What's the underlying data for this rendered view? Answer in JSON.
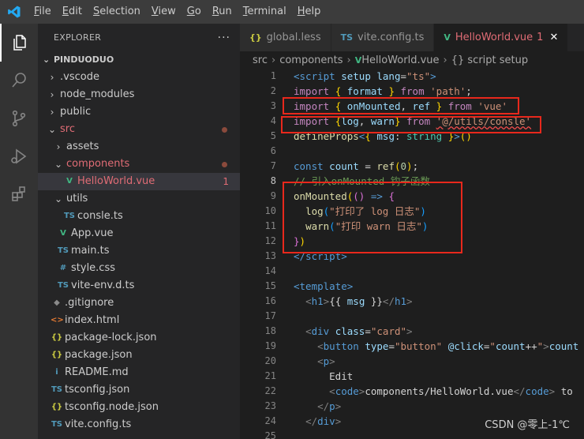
{
  "menubar": {
    "items": [
      "File",
      "Edit",
      "Selection",
      "View",
      "Go",
      "Run",
      "Terminal",
      "Help"
    ]
  },
  "activitybar": {
    "icons": [
      "files-icon",
      "search-icon",
      "source-control-icon",
      "run-debug-icon",
      "extensions-icon"
    ]
  },
  "explorer": {
    "title": "EXPLORER",
    "more": "···",
    "project": "PINDUODUO",
    "items": [
      {
        "label": ".vscode",
        "kind": "folder",
        "depth": 1,
        "open": false
      },
      {
        "label": "node_modules",
        "kind": "folder",
        "depth": 1,
        "open": false
      },
      {
        "label": "public",
        "kind": "folder",
        "depth": 1,
        "open": false
      },
      {
        "label": "src",
        "kind": "folder",
        "depth": 1,
        "open": true,
        "modified": true
      },
      {
        "label": "assets",
        "kind": "folder",
        "depth": 2,
        "open": false
      },
      {
        "label": "components",
        "kind": "folder",
        "depth": 2,
        "open": true,
        "modified": true
      },
      {
        "label": "HelloWorld.vue",
        "kind": "vue",
        "depth": 3,
        "selected": true,
        "problems": "1"
      },
      {
        "label": "utils",
        "kind": "folder",
        "depth": 2,
        "open": true
      },
      {
        "label": "consle.ts",
        "kind": "ts",
        "depth": 3
      },
      {
        "label": "App.vue",
        "kind": "vue",
        "depth": 2
      },
      {
        "label": "main.ts",
        "kind": "ts",
        "depth": 2
      },
      {
        "label": "style.css",
        "kind": "css",
        "depth": 2
      },
      {
        "label": "vite-env.d.ts",
        "kind": "ts",
        "depth": 2
      },
      {
        "label": ".gitignore",
        "kind": "git",
        "depth": 1
      },
      {
        "label": "index.html",
        "kind": "html",
        "depth": 1
      },
      {
        "label": "package-lock.json",
        "kind": "json",
        "depth": 1
      },
      {
        "label": "package.json",
        "kind": "json",
        "depth": 1
      },
      {
        "label": "README.md",
        "kind": "md",
        "depth": 1
      },
      {
        "label": "tsconfig.json",
        "kind": "tsconfig",
        "depth": 1
      },
      {
        "label": "tsconfig.node.json",
        "kind": "json",
        "depth": 1
      },
      {
        "label": "vite.config.ts",
        "kind": "ts",
        "depth": 1
      }
    ]
  },
  "tabs": [
    {
      "label": "global.less",
      "icon": "{}",
      "active": false
    },
    {
      "label": "vite.config.ts",
      "icon": "TS",
      "active": false
    },
    {
      "label": "HelloWorld.vue",
      "icon": "V",
      "active": true,
      "badge": "1",
      "close": "✕"
    }
  ],
  "breadcrumb": [
    "src",
    "components",
    "HelloWorld.vue",
    "{} script setup"
  ],
  "editor": {
    "current_line": 8,
    "lines": [
      [
        [
          "tag",
          "<"
        ],
        [
          "k",
          "script"
        ],
        [
          "v",
          " setup"
        ],
        [
          "d",
          " "
        ],
        [
          "v",
          "lang"
        ],
        [
          "d",
          "="
        ],
        [
          "s",
          "\"ts\""
        ],
        [
          "tag",
          ">"
        ]
      ],
      [
        [
          "kc",
          "import"
        ],
        [
          "d",
          " "
        ],
        [
          "b1",
          "{"
        ],
        [
          "d",
          " "
        ],
        [
          "v",
          "format"
        ],
        [
          "d",
          " "
        ],
        [
          "b1",
          "}"
        ],
        [
          "d",
          " "
        ],
        [
          "kc",
          "from"
        ],
        [
          "d",
          " "
        ],
        [
          "s",
          "'path'"
        ],
        [
          "d",
          ";"
        ]
      ],
      [
        [
          "kc",
          "import"
        ],
        [
          "d",
          " "
        ],
        [
          "b1",
          "{"
        ],
        [
          "d",
          " "
        ],
        [
          "v",
          "onMounted"
        ],
        [
          "d",
          ", "
        ],
        [
          "v",
          "ref"
        ],
        [
          "d",
          " "
        ],
        [
          "b1",
          "}"
        ],
        [
          "d",
          " "
        ],
        [
          "kc",
          "from"
        ],
        [
          "d",
          " "
        ],
        [
          "s",
          "'vue'"
        ]
      ],
      [
        [
          "kc",
          "import"
        ],
        [
          "d",
          " "
        ],
        [
          "b1",
          "{"
        ],
        [
          "v",
          "log"
        ],
        [
          "d",
          ", "
        ],
        [
          "v",
          "warn"
        ],
        [
          "b1",
          "}"
        ],
        [
          "d",
          " "
        ],
        [
          "kc",
          "from"
        ],
        [
          "d",
          " "
        ],
        [
          "sq",
          "'@/utils/consle'"
        ]
      ],
      [
        [
          "f",
          "defineProps"
        ],
        [
          "tag",
          "<"
        ],
        [
          "b1",
          "{"
        ],
        [
          "d",
          " "
        ],
        [
          "v",
          "msg"
        ],
        [
          "d",
          ": "
        ],
        [
          "t",
          "string"
        ],
        [
          "d",
          " "
        ],
        [
          "b1",
          "}"
        ],
        [
          "tag",
          ">"
        ],
        [
          "b1",
          "("
        ],
        [
          "b1",
          ")"
        ]
      ],
      [],
      [
        [
          "k",
          "const"
        ],
        [
          "d",
          " "
        ],
        [
          "v",
          "count"
        ],
        [
          "d",
          " = "
        ],
        [
          "f",
          "ref"
        ],
        [
          "b1",
          "("
        ],
        [
          "n",
          "0"
        ],
        [
          "b1",
          ")"
        ],
        [
          "d",
          ";"
        ]
      ],
      [
        [
          "c",
          "// 引入onMounted 钩子函数"
        ]
      ],
      [
        [
          "f",
          "onMounted"
        ],
        [
          "b1",
          "("
        ],
        [
          "b2",
          "("
        ],
        [
          "b2",
          ")"
        ],
        [
          "d",
          " "
        ],
        [
          "k",
          "=>"
        ],
        [
          "d",
          " "
        ],
        [
          "b2",
          "{"
        ]
      ],
      [
        [
          "d",
          "  "
        ],
        [
          "f",
          "log"
        ],
        [
          "b3",
          "("
        ],
        [
          "s",
          "\"打印了 log 日志\""
        ],
        [
          "b3",
          ")"
        ]
      ],
      [
        [
          "d",
          "  "
        ],
        [
          "f",
          "warn"
        ],
        [
          "b3",
          "("
        ],
        [
          "s",
          "\"打印 warn 日志\""
        ],
        [
          "b3",
          ")"
        ]
      ],
      [
        [
          "b2",
          "}"
        ],
        [
          "b1",
          ")"
        ]
      ],
      [
        [
          "tag",
          "</"
        ],
        [
          "k",
          "script"
        ],
        [
          "tag",
          ">"
        ]
      ],
      [],
      [
        [
          "tag",
          "<"
        ],
        [
          "k",
          "template"
        ],
        [
          "tag",
          ">"
        ]
      ],
      [
        [
          "d",
          "  "
        ],
        [
          "br",
          "<"
        ],
        [
          "k",
          "h1"
        ],
        [
          "br",
          ">"
        ],
        [
          "d",
          "{{ "
        ],
        [
          "v",
          "msg"
        ],
        [
          "d",
          " }}"
        ],
        [
          "br",
          "</"
        ],
        [
          "k",
          "h1"
        ],
        [
          "br",
          ">"
        ]
      ],
      [],
      [
        [
          "d",
          "  "
        ],
        [
          "br",
          "<"
        ],
        [
          "k",
          "div"
        ],
        [
          "d",
          " "
        ],
        [
          "v",
          "class"
        ],
        [
          "d",
          "="
        ],
        [
          "s",
          "\"card\""
        ],
        [
          "br",
          ">"
        ]
      ],
      [
        [
          "d",
          "    "
        ],
        [
          "br",
          "<"
        ],
        [
          "k",
          "button"
        ],
        [
          "d",
          " "
        ],
        [
          "v",
          "type"
        ],
        [
          "d",
          "="
        ],
        [
          "s",
          "\"button\""
        ],
        [
          "d",
          " "
        ],
        [
          "v",
          "@click"
        ],
        [
          "d",
          "="
        ],
        [
          "s",
          "\""
        ],
        [
          "v",
          "count"
        ],
        [
          "d",
          "++"
        ],
        [
          "s",
          "\""
        ],
        [
          "br",
          ">"
        ],
        [
          "v",
          "count"
        ]
      ],
      [
        [
          "d",
          "    "
        ],
        [
          "br",
          "<"
        ],
        [
          "k",
          "p"
        ],
        [
          "br",
          ">"
        ]
      ],
      [
        [
          "d",
          "      Edit"
        ]
      ],
      [
        [
          "d",
          "      "
        ],
        [
          "br",
          "<"
        ],
        [
          "k",
          "code"
        ],
        [
          "br",
          ">"
        ],
        [
          "d",
          "components/HelloWorld.vue"
        ],
        [
          "br",
          "</"
        ],
        [
          "k",
          "code"
        ],
        [
          "br",
          ">"
        ],
        [
          "d",
          " to"
        ]
      ],
      [
        [
          "d",
          "    "
        ],
        [
          "br",
          "</"
        ],
        [
          "k",
          "p"
        ],
        [
          "br",
          ">"
        ]
      ],
      [
        [
          "d",
          "  "
        ],
        [
          "br",
          "</"
        ],
        [
          "k",
          "div"
        ],
        [
          "br",
          ">"
        ]
      ],
      []
    ]
  },
  "watermark": "CSDN @零上-1℃"
}
